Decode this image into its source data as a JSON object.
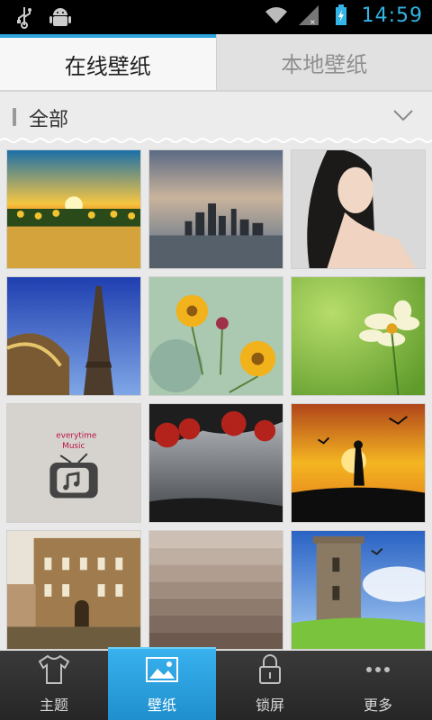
{
  "status_bar": {
    "time": "14:59",
    "icons": [
      "usb-icon",
      "android-debug-icon",
      "wifi-icon",
      "signal-icon",
      "battery-charging-icon"
    ]
  },
  "tabs": [
    {
      "label": "在线壁纸",
      "active": true
    },
    {
      "label": "本地壁纸",
      "active": false
    }
  ],
  "category": {
    "label": "全部"
  },
  "wallpapers": [
    {
      "name": "sunflower-sunset"
    },
    {
      "name": "city-skyline"
    },
    {
      "name": "portrait-woman"
    },
    {
      "name": "eiffel-tower"
    },
    {
      "name": "yellow-flowers"
    },
    {
      "name": "cosmos-green"
    },
    {
      "name": "retro-tv"
    },
    {
      "name": "red-tree-sky"
    },
    {
      "name": "silhouette-sunset"
    },
    {
      "name": "flooded-street"
    },
    {
      "name": "brown-gradient"
    },
    {
      "name": "stone-tower"
    }
  ],
  "bottom_nav": [
    {
      "label": "主题",
      "icon": "tshirt-icon",
      "active": false
    },
    {
      "label": "壁纸",
      "icon": "picture-icon",
      "active": true
    },
    {
      "label": "锁屏",
      "icon": "lock-icon",
      "active": false
    },
    {
      "label": "更多",
      "icon": "more-icon",
      "active": false
    }
  ],
  "colors": {
    "accent": "#2ea3dc",
    "time": "#33b5e5"
  }
}
